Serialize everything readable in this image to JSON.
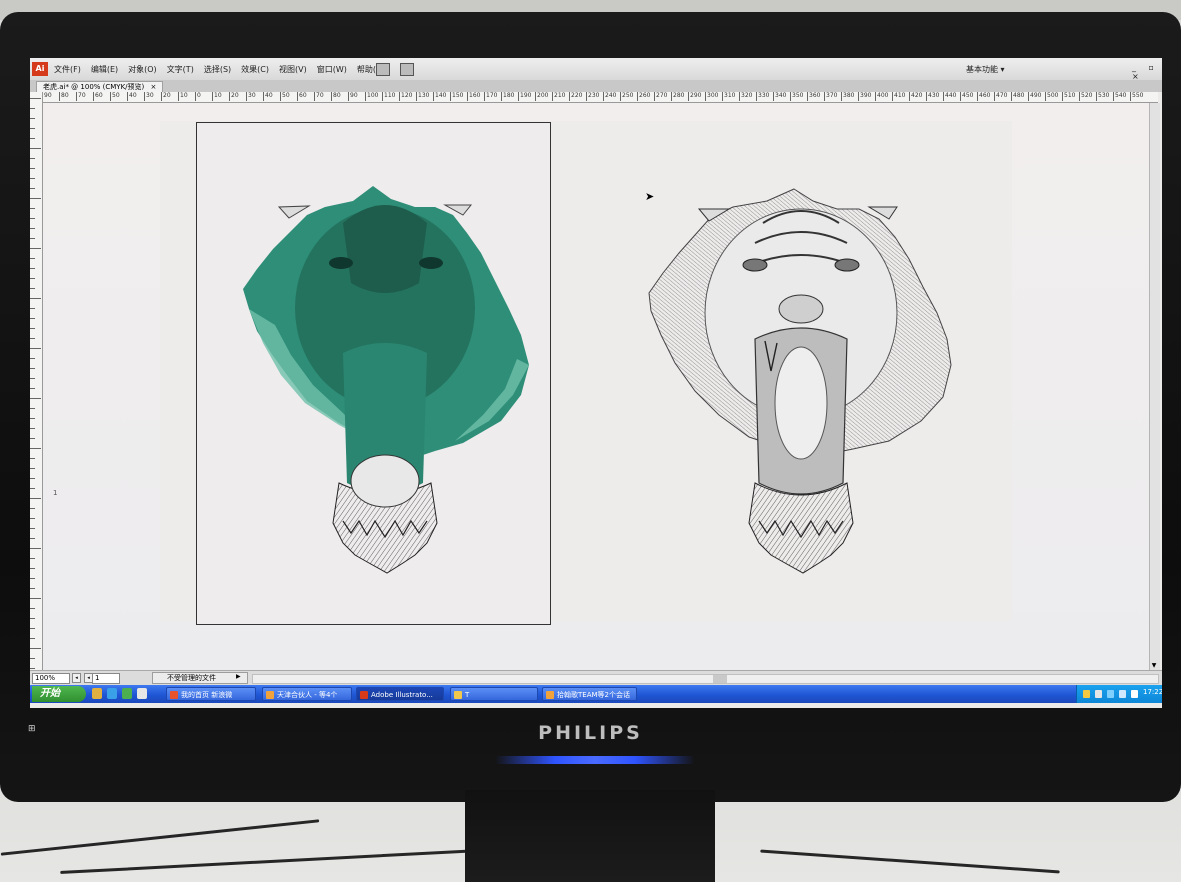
{
  "monitor": {
    "brand": "PHILIPS"
  },
  "menubar": {
    "app_logo": "Ai",
    "items": [
      "文件(F)",
      "编辑(E)",
      "对象(O)",
      "文字(T)",
      "选择(S)",
      "效果(C)",
      "视图(V)",
      "窗口(W)",
      "帮助(H)"
    ],
    "workspace": "基本功能 ▾",
    "window_controls": "_ ▫ ×"
  },
  "document": {
    "tab_label": "老虎.ai* @ 100% (CMYK/预览)",
    "tab_close": "×"
  },
  "ruler": {
    "ticks": [
      "90",
      "80",
      "70",
      "60",
      "50",
      "40",
      "30",
      "20",
      "10",
      "0",
      "10",
      "20",
      "30",
      "40",
      "50",
      "60",
      "70",
      "80",
      "90",
      "100",
      "110",
      "120",
      "130",
      "140",
      "150",
      "160",
      "170",
      "180",
      "190",
      "200",
      "210",
      "220",
      "230",
      "240",
      "250",
      "260",
      "270",
      "280",
      "290",
      "300",
      "310",
      "320",
      "330",
      "340",
      "350",
      "360",
      "370",
      "380",
      "390",
      "400",
      "410",
      "420",
      "430",
      "440",
      "450",
      "460",
      "470",
      "480",
      "490",
      "500",
      "510",
      "520",
      "530",
      "540",
      "550"
    ]
  },
  "canvas": {
    "page_marker": "1",
    "tint_color": "#2a8a74"
  },
  "statusbar": {
    "zoom": "100%",
    "page": "1",
    "status_text": "不受管理的文件"
  },
  "taskbar": {
    "start": "开始",
    "tasks": [
      {
        "label": "我的首页 新浪微",
        "icon_color": "#e8532b"
      },
      {
        "label": "天津合伙人 - 等4个",
        "icon_color": "#f2a23a"
      },
      {
        "label": "Adobe Illustrato...",
        "icon_color": "#d53b1a"
      },
      {
        "label": "T",
        "icon_color": "#f1c84b"
      },
      {
        "label": "拾翰歌TEAM等2个会话",
        "icon_color": "#f2a23a"
      }
    ],
    "clock": "17:22"
  }
}
